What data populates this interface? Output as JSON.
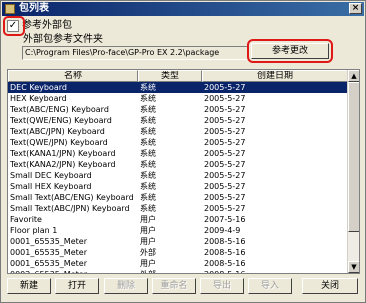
{
  "window": {
    "title": "包列表",
    "close_label": "×"
  },
  "external_package": {
    "checked_mark": "✓",
    "label": "参考外部包"
  },
  "folder": {
    "label": "外部包参考文件夹",
    "path": "C:\\Program Files\\Pro-face\\GP-Pro EX 2.2\\package",
    "change_button": "参考更改"
  },
  "table": {
    "columns": [
      "名称",
      "类型",
      "创建日期"
    ],
    "rows": [
      {
        "name": "DEC Keyboard",
        "type": "系统",
        "date": "2005-5-27",
        "selected": true
      },
      {
        "name": "HEX Keyboard",
        "type": "系统",
        "date": "2005-5-27"
      },
      {
        "name": "Text(ABC/ENG) Keyboard",
        "type": "系统",
        "date": "2005-5-27"
      },
      {
        "name": "Text(QWE/ENG) Keyboard",
        "type": "系统",
        "date": "2005-5-27"
      },
      {
        "name": "Text(ABC/JPN) Keyboard",
        "type": "系统",
        "date": "2005-5-27"
      },
      {
        "name": "Text(QWE/JPN) Keyboard",
        "type": "系统",
        "date": "2005-5-27"
      },
      {
        "name": "Text(KANA1/JPN) Keyboard",
        "type": "系统",
        "date": "2005-5-27"
      },
      {
        "name": "Text(KANA2/JPN) Keyboard",
        "type": "系统",
        "date": "2005-5-27"
      },
      {
        "name": "Small DEC Keyboard",
        "type": "系统",
        "date": "2005-5-27"
      },
      {
        "name": "Small HEX Keyboard",
        "type": "系统",
        "date": "2005-5-27"
      },
      {
        "name": "Small Text(ABC/ENG) Keyboard",
        "type": "系统",
        "date": "2005-5-27"
      },
      {
        "name": "Small Text(ABC/JPN) Keyboard",
        "type": "系统",
        "date": "2005-5-27"
      },
      {
        "name": "Favorite",
        "type": "用户",
        "date": "2007-5-16"
      },
      {
        "name": "Floor plan 1",
        "type": "用户",
        "date": "2009-4-9"
      },
      {
        "name": "0001_65535_Meter",
        "type": "用户",
        "date": "2008-5-16"
      },
      {
        "name": "0001_65535_Meter",
        "type": "外部",
        "date": "2008-5-16"
      },
      {
        "name": "0001_65535_Meter",
        "type": "用户",
        "date": "2008-5-16"
      },
      {
        "name": "0002_65535_Meter",
        "type": "外部",
        "date": "2008-5-16"
      }
    ]
  },
  "scrollbar": {
    "up_icon": "▲",
    "down_icon": "▼"
  },
  "buttons": {
    "new": "新建",
    "open": "打开",
    "delete": "删除",
    "rename": "重命名",
    "export": "导出",
    "import": "导入",
    "close": "关闭"
  }
}
